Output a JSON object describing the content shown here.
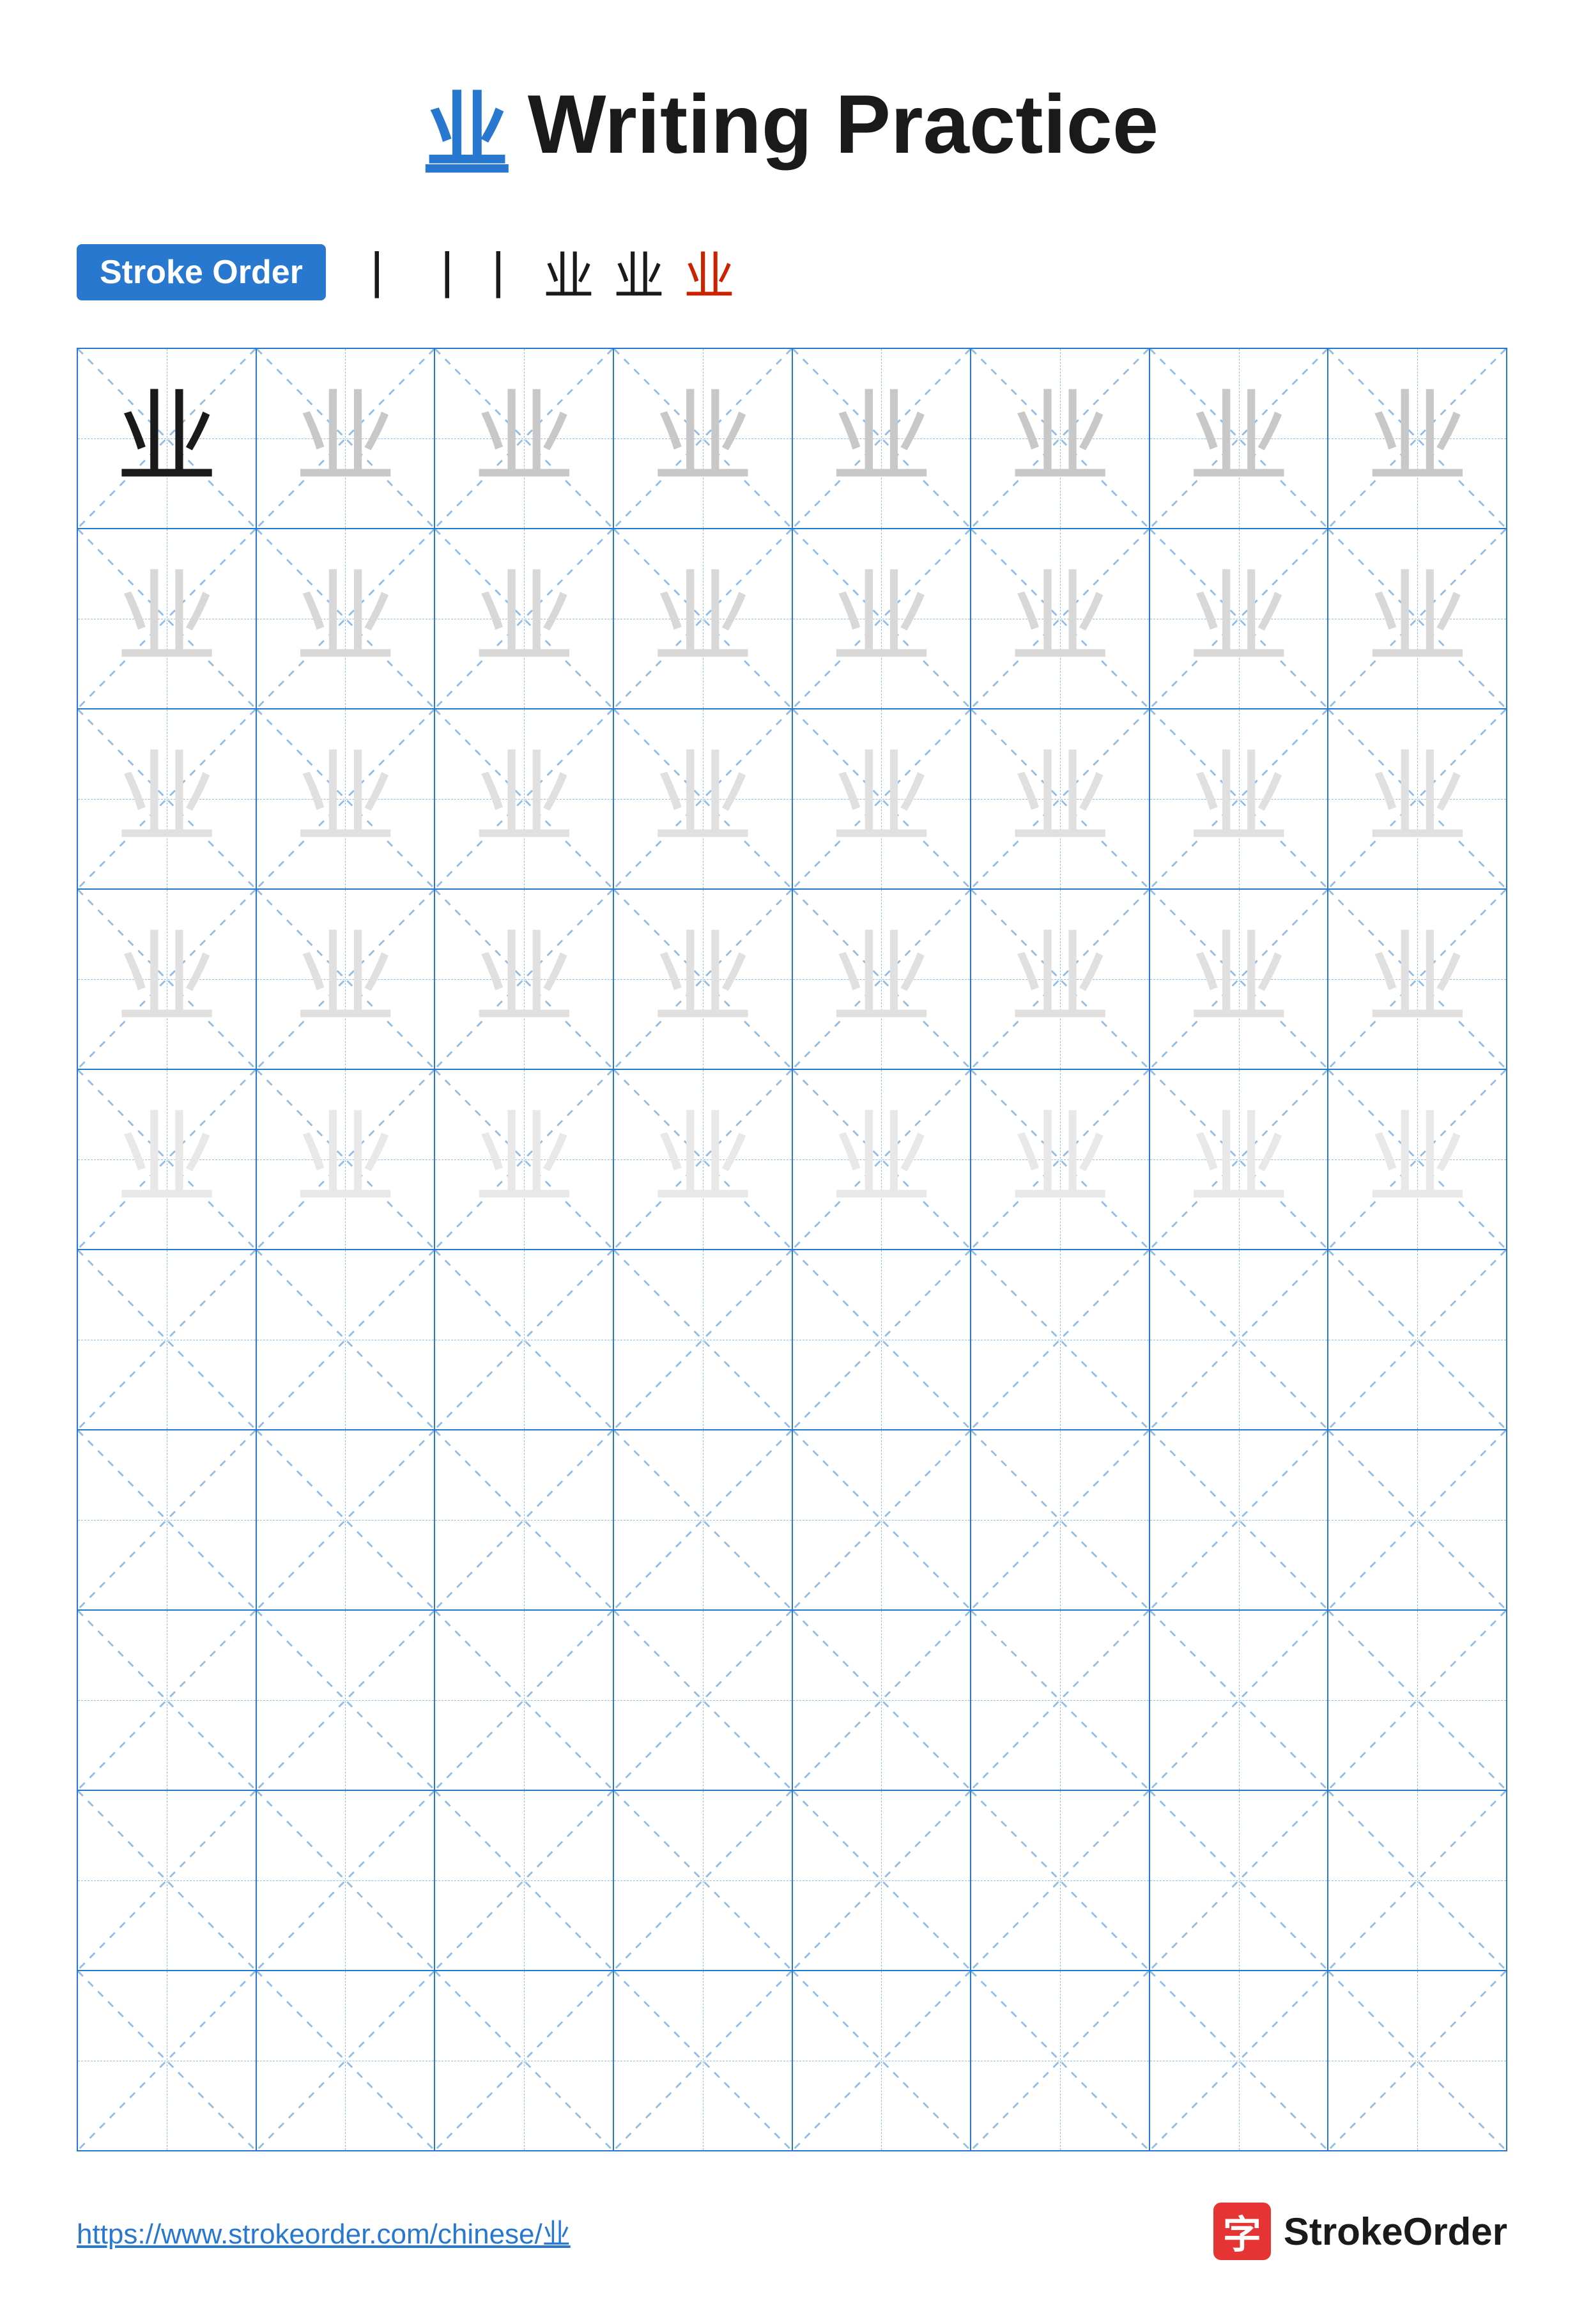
{
  "title": {
    "chinese": "业",
    "text": "Writing Practice"
  },
  "stroke_order": {
    "badge_label": "Stroke Order",
    "strokes": [
      "丨",
      "丨丨",
      "业",
      "业",
      "业"
    ]
  },
  "grid": {
    "rows": 10,
    "cols": 8,
    "character": "业"
  },
  "footer": {
    "url": "https://www.strokeorder.com/chinese/业",
    "logo_text": "StrokeOrder",
    "logo_char": "字"
  }
}
